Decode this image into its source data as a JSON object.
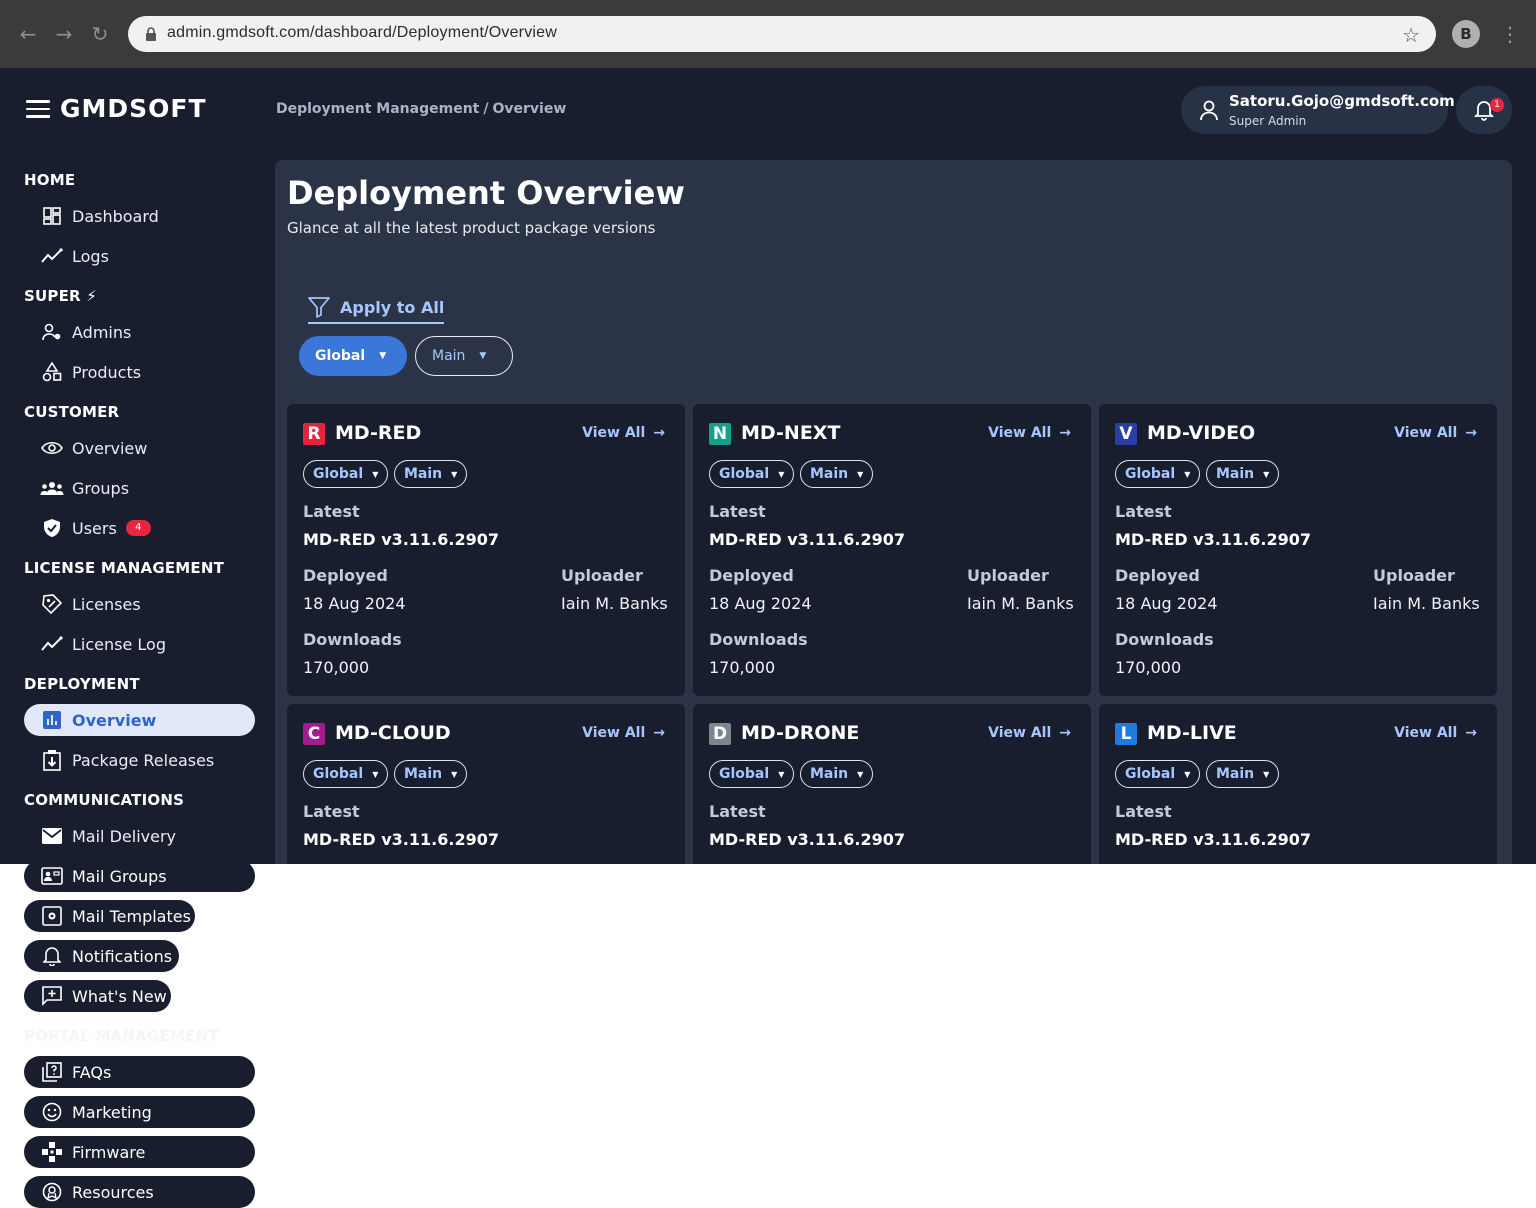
{
  "browser": {
    "url": "admin.gmdsoft.com/dashboard/Deployment/Overview",
    "profile_initial": "B"
  },
  "header": {
    "logo": "GMDSOFT",
    "breadcrumb": [
      "Deployment Management",
      "Overview"
    ],
    "breadcrumb_sep": "/",
    "user_email": "Satoru.Gojo@gmdsoft.com",
    "user_role": "Super Admin",
    "notification_count": "1"
  },
  "sidebar": {
    "sections": [
      {
        "title": "HOME",
        "items": [
          "Dashboard",
          "Logs"
        ]
      },
      {
        "title": "SUPER",
        "items": [
          "Admins",
          "Products"
        ]
      },
      {
        "title": "CUSTOMER",
        "items": [
          "Overview",
          "Groups",
          "Users"
        ]
      },
      {
        "title": "LICENSE MANAGEMENT",
        "items": [
          "Licenses",
          "License Log"
        ]
      },
      {
        "title": "DEPLOYMENT",
        "items": [
          "Overview",
          "Package Releases"
        ]
      },
      {
        "title": "COMMUNICATIONS",
        "items": [
          "Mail Delivery",
          "Mail Groups",
          "Mail Templates",
          "Notifications",
          "What's New"
        ]
      },
      {
        "title": "PORTAL MANAGEMENT",
        "items": [
          "FAQs",
          "Marketing",
          "Firmware",
          "Resources"
        ]
      }
    ],
    "users_badge": "4",
    "active_item": "Overview"
  },
  "main": {
    "title": "Deployment Overview",
    "subtitle": "Glance at all the latest product package versions",
    "apply_label": "Apply to All",
    "filter_region": "Global",
    "filter_branch": "Main",
    "view_all_label": "View All",
    "labels": {
      "latest": "Latest",
      "deployed": "Deployed",
      "uploader": "Uploader",
      "downloads": "Downloads"
    },
    "cards": [
      {
        "letter": "R",
        "name": "MD-RED",
        "color": "#e5243b",
        "region": "Global",
        "branch": "Main",
        "latest": "MD-RED v3.11.6.2907",
        "deployed": "18 Aug 2024",
        "uploader": "Iain M. Banks",
        "downloads": "170,000"
      },
      {
        "letter": "N",
        "name": "MD-NEXT",
        "color": "#14a08a",
        "region": "Global",
        "branch": "Main",
        "latest": "MD-RED v3.11.6.2907",
        "deployed": "18 Aug 2024",
        "uploader": "Iain M. Banks",
        "downloads": "170,000"
      },
      {
        "letter": "V",
        "name": "MD-VIDEO",
        "color": "#2a3ea8",
        "region": "Global",
        "branch": "Main",
        "latest": "MD-RED v3.11.6.2907",
        "deployed": "18 Aug 2024",
        "uploader": "Iain M. Banks",
        "downloads": "170,000"
      },
      {
        "letter": "C",
        "name": "MD-CLOUD",
        "color": "#a21c8e",
        "region": "Global",
        "branch": "Main",
        "latest": "MD-RED v3.11.6.2907"
      },
      {
        "letter": "D",
        "name": "MD-DRONE",
        "color": "#7d8590",
        "region": "Global",
        "branch": "Main",
        "latest": "MD-RED v3.11.6.2907"
      },
      {
        "letter": "L",
        "name": "MD-LIVE",
        "color": "#1e7bdf",
        "region": "Global",
        "branch": "Main",
        "latest": "MD-RED v3.11.6.2907"
      }
    ]
  }
}
